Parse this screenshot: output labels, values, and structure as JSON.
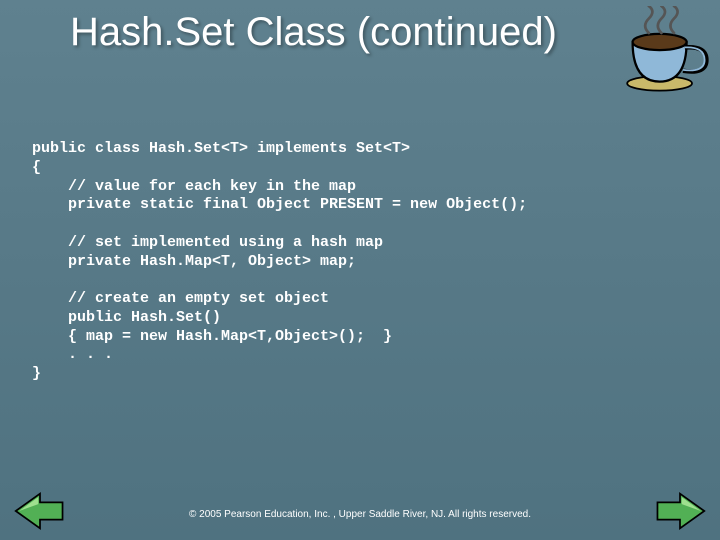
{
  "title": "Hash.Set Class (continued)",
  "code": "public class Hash.Set<T> implements Set<T>\n{\n    // value for each key in the map\n    private static final Object PRESENT = new Object();\n\n    // set implemented using a hash map\n    private Hash.Map<T, Object> map;\n\n    // create an empty set object\n    public Hash.Set()\n    { map = new Hash.Map<T,Object>();  }\n    . . .\n}",
  "footer": "© 2005 Pearson Education, Inc. , Upper Saddle River, NJ.  All rights reserved.",
  "icons": {
    "coffee": "coffee-cup-icon",
    "prev": "prev-arrow-icon",
    "next": "next-arrow-icon"
  }
}
